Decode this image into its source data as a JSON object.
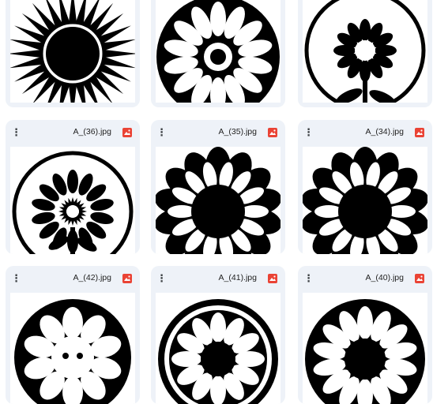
{
  "colors": {
    "card_bg": "#eef2f8",
    "image_icon": "#ea4335",
    "icon_color": "#3c4043"
  },
  "files": [
    {
      "name": "",
      "icon": "sun-flower-thumbnail"
    },
    {
      "name": "",
      "icon": "daisy-circle-thumbnail"
    },
    {
      "name": "",
      "icon": "flower-stem-circle-thumbnail"
    },
    {
      "name": "A_(36).jpg",
      "icon": "sunflower-stem-circle-thumbnail"
    },
    {
      "name": "A_(35).jpg",
      "icon": "sunflower-thumbnail"
    },
    {
      "name": "A_(34).jpg",
      "icon": "sunflower-thumbnail"
    },
    {
      "name": "A_(42).jpg",
      "icon": "smiley-flower-thumbnail"
    },
    {
      "name": "A_(41).jpg",
      "icon": "daisy-ring-thumbnail"
    },
    {
      "name": "A_(40).jpg",
      "icon": "daisy-circle-thumbnail"
    }
  ],
  "menu_icon": "⋮"
}
